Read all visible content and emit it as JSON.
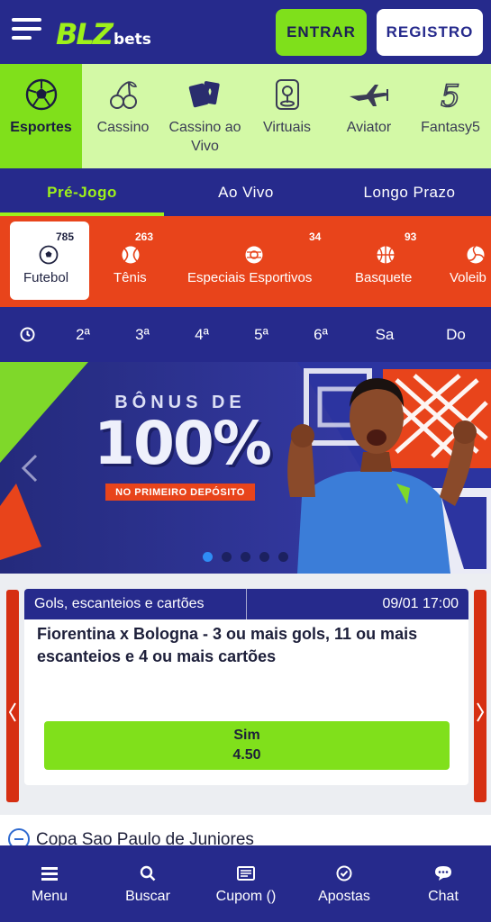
{
  "header": {
    "logo_main": "BLZ",
    "logo_sub": "bets",
    "login_label": "ENTRAR",
    "register_label": "REGISTRO"
  },
  "categories": [
    {
      "label": "Esportes",
      "icon": "soccer-ball-icon",
      "active": true
    },
    {
      "label": "Cassino",
      "icon": "cherries-icon"
    },
    {
      "label": "Cassino ao Vivo",
      "icon": "playing-cards-icon"
    },
    {
      "label": "Virtuais",
      "icon": "joystick-icon"
    },
    {
      "label": "Aviator",
      "icon": "airplane-icon"
    },
    {
      "label": "Fantasy5",
      "icon": "fantasy5-icon"
    }
  ],
  "tabs": [
    {
      "label": "Pré-Jogo",
      "active": true
    },
    {
      "label": "Ao Vivo"
    },
    {
      "label": "Longo Prazo"
    }
  ],
  "sports": [
    {
      "label": "Futebol",
      "count": "785",
      "icon": "soccer-ball-icon",
      "active": true
    },
    {
      "label": "Tênis",
      "count": "263",
      "icon": "tennis-ball-icon"
    },
    {
      "label": "Especiais Esportivos",
      "count": "34",
      "icon": "special-ball-icon"
    },
    {
      "label": "Basquete",
      "count": "93",
      "icon": "basketball-icon"
    },
    {
      "label": "Voleib",
      "count": "",
      "icon": "volleyball-icon"
    }
  ],
  "days": [
    "2ª",
    "3ª",
    "4ª",
    "5ª",
    "6ª",
    "Sa",
    "Do"
  ],
  "banner": {
    "line1": "BÔNUS DE",
    "line2": "100%",
    "ribbon": "NO PRIMEIRO DEPÓSITO",
    "active_slide": 1,
    "slide_count": 5
  },
  "match": {
    "market": "Gols, escanteios e cartões",
    "datetime": "09/01 17:00",
    "title": "Fiorentina x Bologna - 3 ou mais gols, 11 ou mais escanteios e 4 ou mais cartões",
    "odd_label": "Sim",
    "odd_value": "4.50"
  },
  "league": {
    "name": "Copa Sao Paulo de Juniores"
  },
  "bottom_nav": [
    {
      "label": "Menu",
      "icon": "menu-icon"
    },
    {
      "label": "Buscar",
      "icon": "search-icon"
    },
    {
      "label": "Cupom ()",
      "icon": "coupon-icon"
    },
    {
      "label": "Apostas",
      "icon": "bets-check-icon"
    },
    {
      "label": "Chat",
      "icon": "chat-icon"
    }
  ],
  "colors": {
    "navy": "#262a8c",
    "lime": "#80e01b",
    "orange": "#e8441b",
    "pale_green": "#d3f9a6"
  }
}
